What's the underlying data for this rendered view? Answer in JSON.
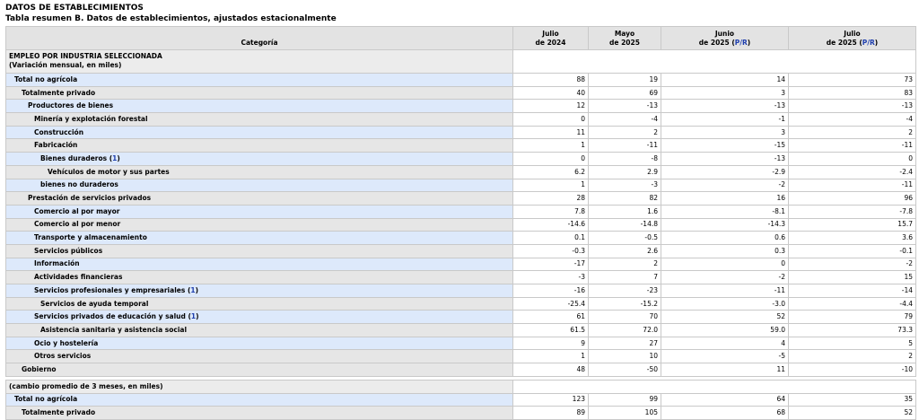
{
  "title": "DATOS DE ESTABLECIMIENTOS",
  "subtitle": "Tabla resumen B. Datos de establecimientos, ajustados estacionalmente",
  "headers": {
    "category": "Categoría",
    "col1_line1": "Julio",
    "col1_line2": "de 2024",
    "col2_line1": "Mayo",
    "col2_line2": "de 2025",
    "col3_line1": "Junio",
    "col3_line2": "de 2025 (",
    "col3_pr": "P/R",
    "col3_close": ")",
    "col4_line1": "Julio",
    "col4_line2": "de 2025 (",
    "col4_pr": "P/R",
    "col4_close": ")"
  },
  "section1": {
    "line1": "EMPLEO POR INDUSTRIA SELECCIONADA",
    "line2": "(Variación mensual, en miles)"
  },
  "rows": [
    {
      "label": "Total no agrícola",
      "v": [
        "88",
        "19",
        "14",
        "73"
      ]
    },
    {
      "label": "Totalmente privado",
      "v": [
        "40",
        "69",
        "3",
        "83"
      ]
    },
    {
      "label": "Productores de bienes",
      "v": [
        "12",
        "-13",
        "-13",
        "-13"
      ]
    },
    {
      "label": "Minería y explotación forestal",
      "v": [
        "0",
        "-4",
        "-1",
        "-4"
      ]
    },
    {
      "label": "Construcción",
      "v": [
        "11",
        "2",
        "3",
        "2"
      ]
    },
    {
      "label": "Fabricación",
      "v": [
        "1",
        "-11",
        "-15",
        "-11"
      ]
    },
    {
      "label": "Bienes duraderos",
      "fn": "1",
      "v": [
        "0",
        "-8",
        "-13",
        "0"
      ]
    },
    {
      "label": "Vehículos de motor y sus partes",
      "v": [
        "6.2",
        "2.9",
        "-2.9",
        "-2.4"
      ]
    },
    {
      "label": "bienes no duraderos",
      "v": [
        "1",
        "-3",
        "-2",
        "-11"
      ]
    },
    {
      "label": "Prestación de servicios privados",
      "v": [
        "28",
        "82",
        "16",
        "96"
      ]
    },
    {
      "label": "Comercio al por mayor",
      "v": [
        "7.8",
        "1.6",
        "-8.1",
        "-7.8"
      ]
    },
    {
      "label": "Comercio al por menor",
      "v": [
        "-14.6",
        "-14.8",
        "-14.3",
        "15.7"
      ]
    },
    {
      "label": "Transporte y almacenamiento",
      "v": [
        "0.1",
        "-0.5",
        "0.6",
        "3.6"
      ]
    },
    {
      "label": "Servicios públicos",
      "v": [
        "-0.3",
        "2.6",
        "0.3",
        "-0.1"
      ]
    },
    {
      "label": "Información",
      "v": [
        "-17",
        "2",
        "0",
        "-2"
      ]
    },
    {
      "label": "Actividades financieras",
      "v": [
        "-3",
        "7",
        "-2",
        "15"
      ]
    },
    {
      "label": "Servicios profesionales y empresariales",
      "fn": "1",
      "v": [
        "-16",
        "-23",
        "-11",
        "-14"
      ]
    },
    {
      "label": "Servicios de ayuda temporal",
      "v": [
        "-25.4",
        "-15.2",
        "-3.0",
        "-4.4"
      ]
    },
    {
      "label": "Servicios privados de educación y salud",
      "fn": "1",
      "v": [
        "61",
        "70",
        "52",
        "79"
      ]
    },
    {
      "label": "Asistencia sanitaria y asistencia social",
      "v": [
        "61.5",
        "72.0",
        "59.0",
        "73.3"
      ]
    },
    {
      "label": "Ocio y hostelería",
      "v": [
        "9",
        "27",
        "4",
        "5"
      ]
    },
    {
      "label": "Otros servicios",
      "v": [
        "1",
        "10",
        "-5",
        "2"
      ]
    },
    {
      "label": "Gobierno",
      "v": [
        "48",
        "-50",
        "11",
        "-10"
      ]
    }
  ],
  "section2": {
    "label": "(cambio promedio de 3 meses, en miles)"
  },
  "rows2": [
    {
      "label": "Total no agrícola",
      "v": [
        "123",
        "99",
        "64",
        "35"
      ]
    },
    {
      "label": "Totalmente privado",
      "v": [
        "89",
        "105",
        "68",
        "52"
      ]
    }
  ]
}
